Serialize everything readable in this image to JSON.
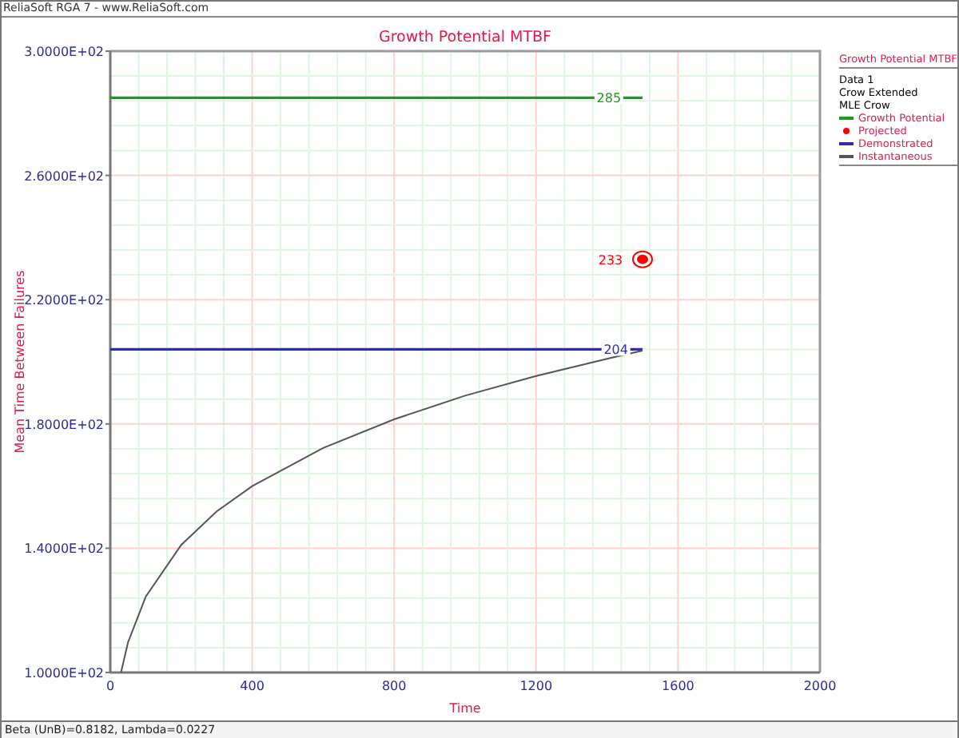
{
  "window": {
    "title": "ReliaSoft RGA 7 - www.ReliaSoft.com"
  },
  "chart": {
    "chart_data": {
      "type": "line",
      "title": "Growth Potential MTBF",
      "xlabel": "Time",
      "ylabel": "Mean Time Between Failures",
      "x": [
        0,
        30,
        50,
        100,
        200,
        300,
        400,
        600,
        800,
        1000,
        1200,
        1400,
        1500
      ],
      "series": [
        {
          "name": "Growth Potential",
          "color": "#1f9a1f",
          "values": [
            285,
            285,
            285,
            285,
            285,
            285,
            285,
            285,
            285,
            285,
            285,
            285,
            285
          ]
        },
        {
          "name": "Projected",
          "marker": "circle",
          "color": "#ff0000",
          "values": [
            null,
            null,
            null,
            null,
            null,
            null,
            null,
            null,
            null,
            null,
            null,
            null,
            233
          ]
        },
        {
          "name": "Demonstrated",
          "color": "#2e2ea6",
          "values": [
            204,
            204,
            204,
            204,
            204,
            204,
            204,
            204,
            204,
            204,
            204,
            204,
            204
          ]
        },
        {
          "name": "Instantaneous",
          "color": "#555555",
          "values": [
            null,
            100.0,
            109.7,
            124.4,
            141.1,
            151.9,
            160.0,
            172.3,
            181.5,
            189.1,
            195.4,
            201.0,
            203.6
          ]
        }
      ],
      "grid": true,
      "xlim": [
        0,
        2000
      ],
      "ylim": [
        100,
        300
      ],
      "xticks": [
        0,
        400,
        800,
        1200,
        1600,
        2000
      ],
      "yticks": [
        {
          "value": 100,
          "label": "1.0000E+02"
        },
        {
          "value": 140,
          "label": "1.4000E+02"
        },
        {
          "value": 180,
          "label": "1.8000E+02"
        },
        {
          "value": 220,
          "label": "2.2000E+02"
        },
        {
          "value": 260,
          "label": "2.6000E+02"
        },
        {
          "value": 300,
          "label": "3.0000E+02"
        }
      ],
      "annotations": [
        {
          "text": "285",
          "x": 1405,
          "y": 285
        },
        {
          "text": "233",
          "x": 1410,
          "y": 233
        },
        {
          "text": "204",
          "x": 1425,
          "y": 204
        }
      ]
    }
  },
  "legend": {
    "title": "Growth Potential MTBF",
    "lines": [
      "Data 1",
      "Crow Extended",
      "MLE Crow"
    ]
  },
  "status_bar": "Beta (UnB)=0.8182, Lambda=0.0227"
}
